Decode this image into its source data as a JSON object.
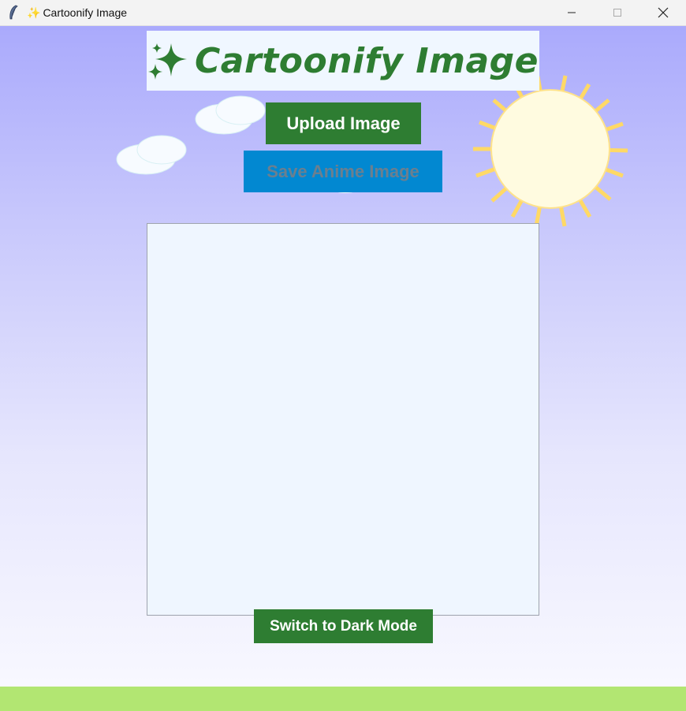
{
  "window": {
    "title_icon": "✨",
    "title": "Cartoonify Image",
    "controls": [
      "minimize-icon",
      "maximize-icon",
      "close-icon"
    ]
  },
  "header": {
    "title": "Cartoonify Image",
    "sparkle_icon": "sparkles-icon"
  },
  "buttons": {
    "upload_label": "Upload Image",
    "save_label": "Save Anime Image",
    "dark_mode_label": "Switch to Dark Mode"
  },
  "colors": {
    "primary_green": "#2e7d32",
    "save_blue": "#0288d1",
    "sky_top": "#aaaafc",
    "sky_bottom": "#f8f8ff",
    "ground": "#b2e672",
    "sun_fill": "#fffbe0",
    "sun_rays": "#ffd966",
    "canvas_bg": "#eff6ff"
  }
}
